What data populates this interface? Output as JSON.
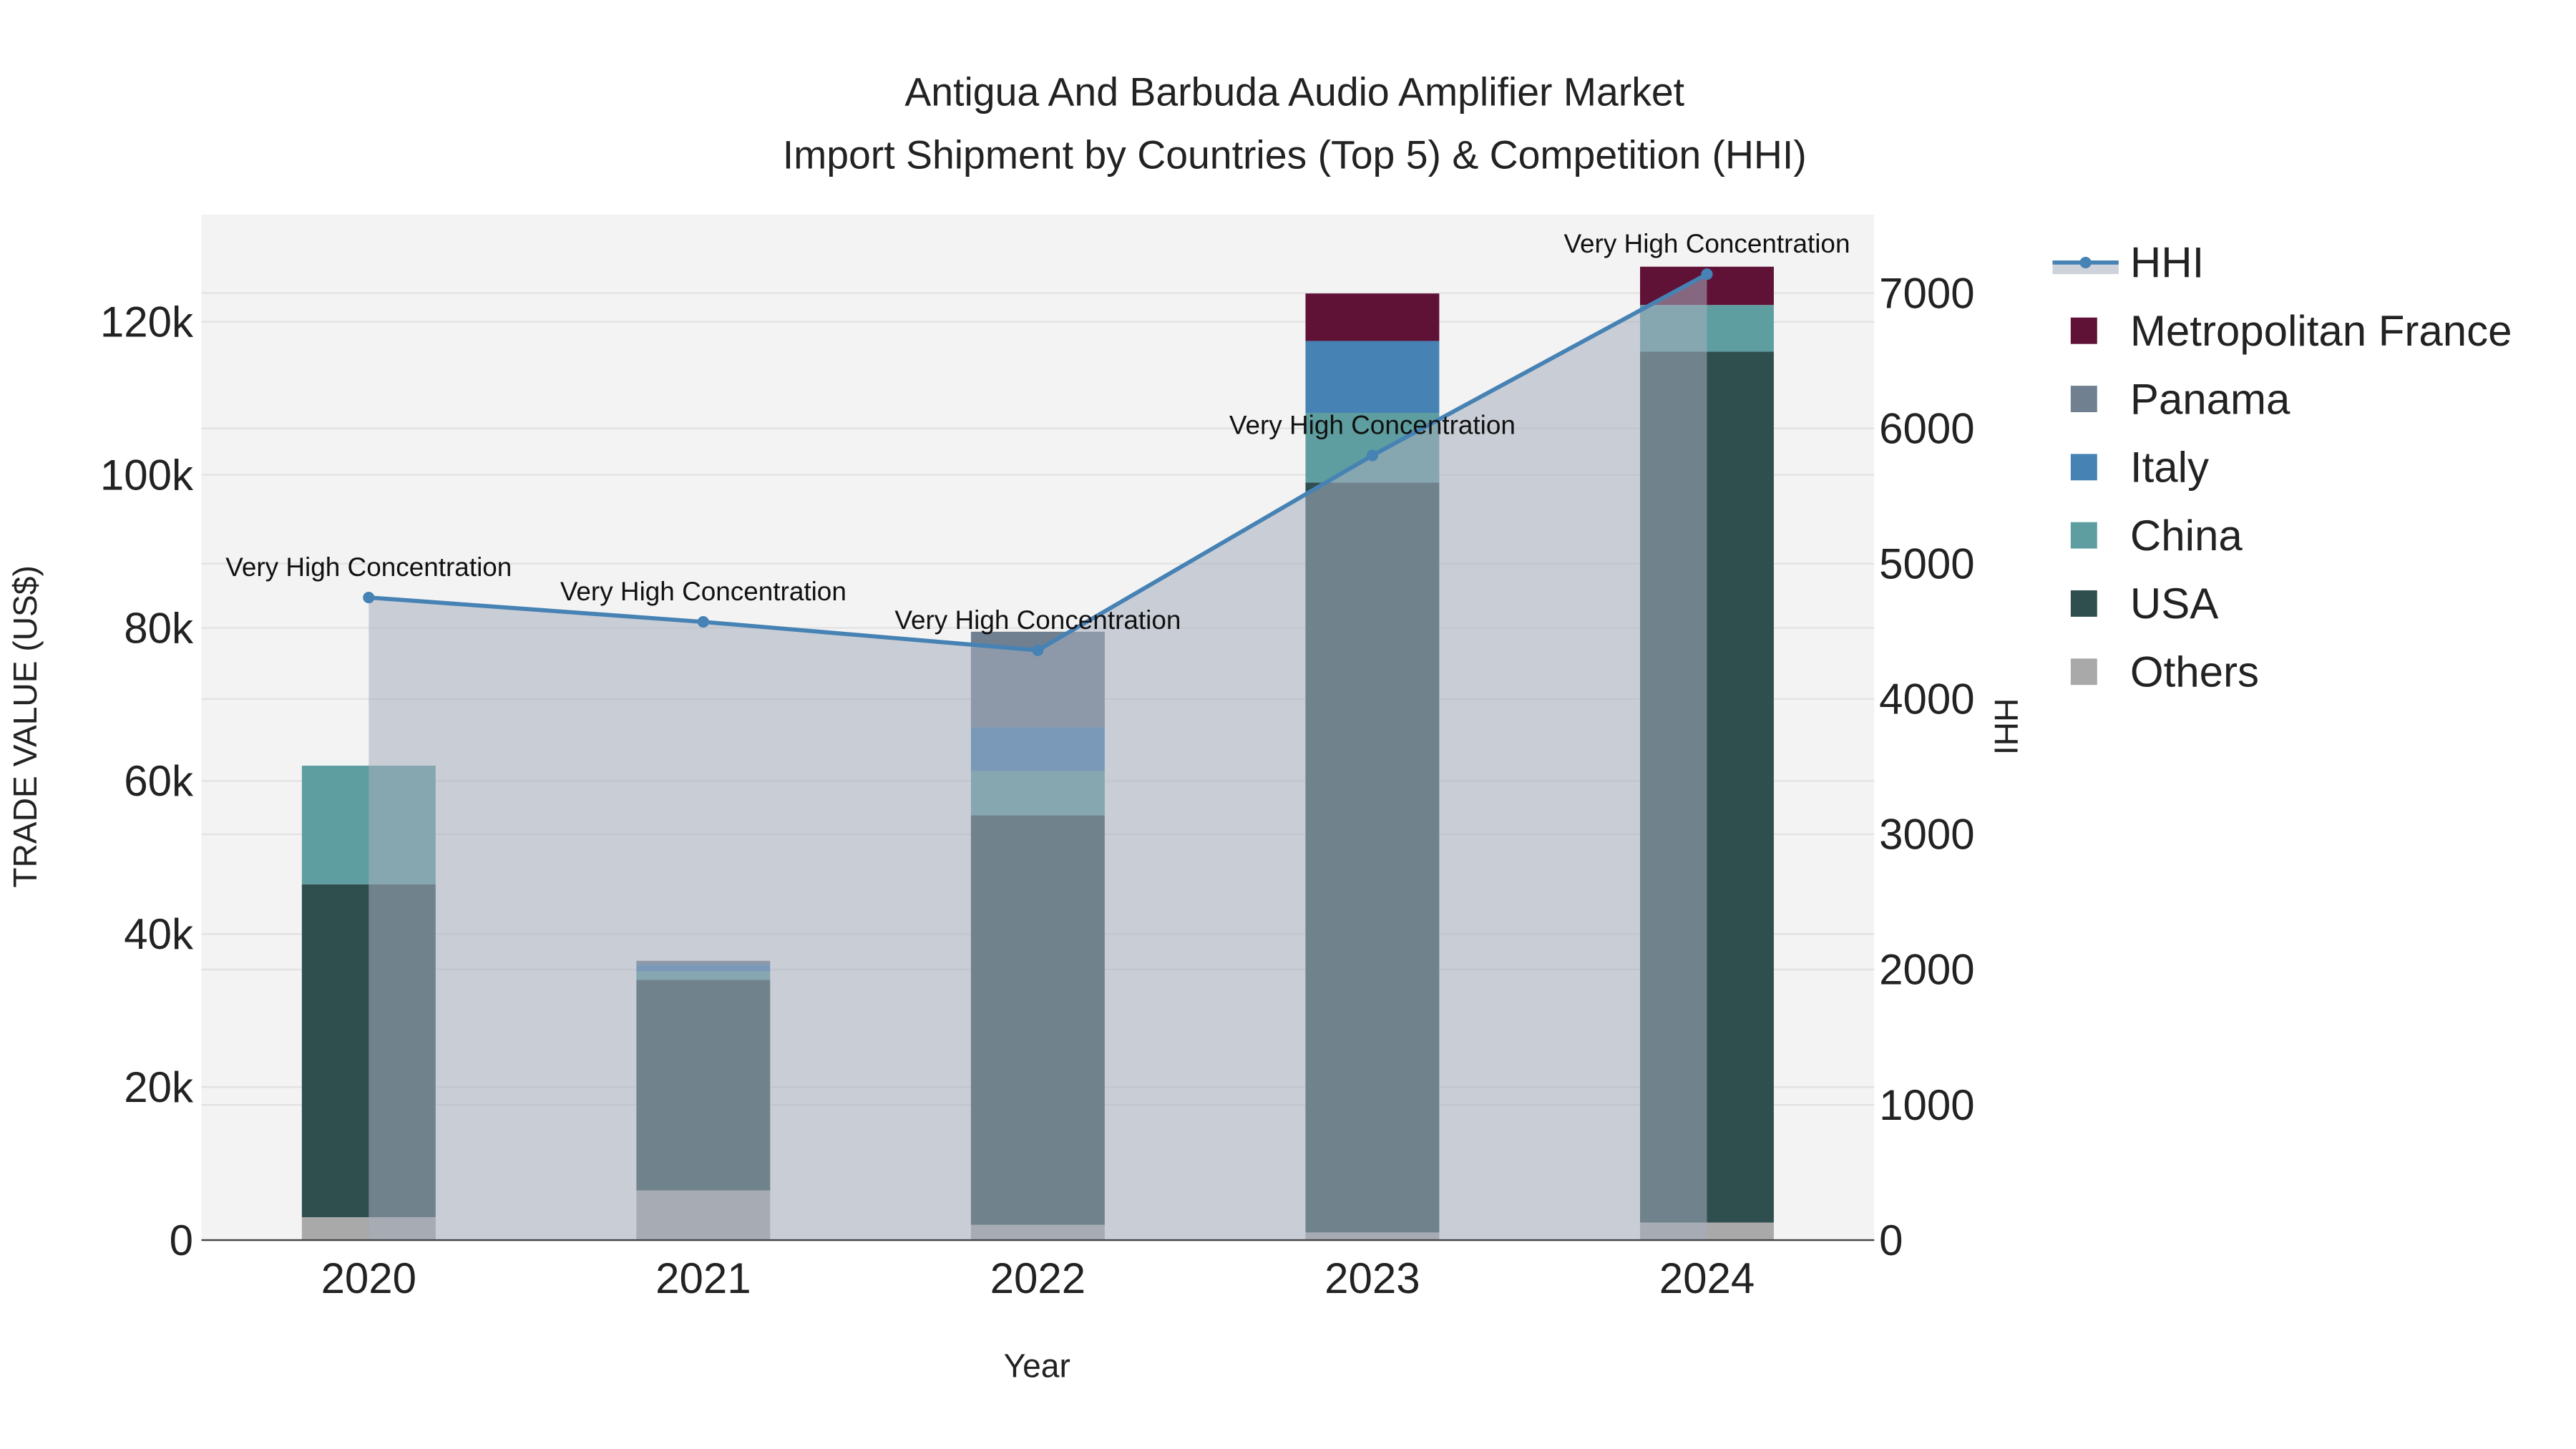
{
  "chart_data": {
    "type": "bar",
    "title_line1": "Antigua And Barbuda Audio Amplifier Market",
    "title_line2": "Import Shipment by Countries (Top 5) & Competition (HHI)",
    "xlabel": "Year",
    "ylabel": "TRADE VALUE (US$)",
    "y2label": "HHI",
    "categories": [
      "2020",
      "2021",
      "2022",
      "2023",
      "2024"
    ],
    "ylim": [
      0,
      134000
    ],
    "y2lim": [
      0,
      7580
    ],
    "yticks": [
      0,
      20000,
      40000,
      60000,
      80000,
      100000,
      120000
    ],
    "ytick_labels": [
      "0",
      "20k",
      "40k",
      "60k",
      "80k",
      "100k",
      "120k"
    ],
    "y2ticks": [
      0,
      1000,
      2000,
      3000,
      4000,
      5000,
      6000,
      7000
    ],
    "y2tick_labels": [
      "0",
      "1000",
      "2000",
      "3000",
      "4000",
      "5000",
      "6000",
      "7000"
    ],
    "series": [
      {
        "name": "Others",
        "color": "#a9a9a9",
        "values": [
          3000,
          6500,
          2000,
          1000,
          2300
        ]
      },
      {
        "name": "USA",
        "color": "#2f4f4f",
        "values": [
          43500,
          27500,
          53500,
          98000,
          113800
        ]
      },
      {
        "name": "China",
        "color": "#5f9ea0",
        "values": [
          15500,
          1100,
          5800,
          9100,
          6100
        ]
      },
      {
        "name": "Italy",
        "color": "#4682b4",
        "values": [
          0,
          900,
          5700,
          9400,
          0
        ]
      },
      {
        "name": "Panama",
        "color": "#708090",
        "values": [
          0,
          500,
          12500,
          0,
          0
        ]
      },
      {
        "name": "Metropolitan France",
        "color": "#5f1236",
        "values": [
          0,
          0,
          0,
          6200,
          5000
        ]
      }
    ],
    "hhi": {
      "name": "HHI",
      "color": "#4682b4",
      "values": [
        4750,
        4570,
        4360,
        5800,
        7140
      ],
      "annotations": [
        "Very High Concentration",
        "Very High Concentration",
        "Very High Concentration",
        "Very High Concentration",
        "Very High Concentration"
      ]
    },
    "legend_order": [
      "HHI",
      "Metropolitan France",
      "Panama",
      "Italy",
      "China",
      "USA",
      "Others"
    ],
    "legend_position": "right",
    "grid": true
  }
}
